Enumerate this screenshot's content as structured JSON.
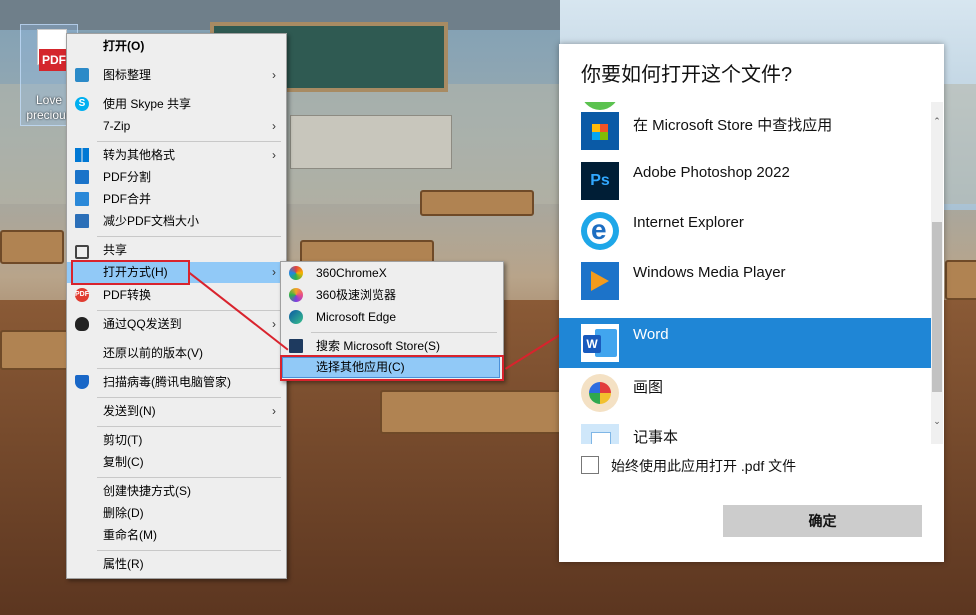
{
  "desktop_icon": {
    "badge": "PDF",
    "label": "Love\nprecious"
  },
  "context_menu": {
    "open": "打开(O)",
    "arrange": "图标整理",
    "skype_share": "使用 Skype 共享",
    "zip": "7-Zip",
    "convert_format": "转为其他格式",
    "pdf_split": "PDF分割",
    "pdf_merge": "PDF合并",
    "pdf_reduce": "减少PDF文档大小",
    "share": "共享",
    "open_with": "打开方式(H)",
    "pdf_convert": "PDF转换",
    "qq_send": "通过QQ发送到",
    "restore": "还原以前的版本(V)",
    "scan_virus": "扫描病毒(腾讯电脑管家)",
    "send_to": "发送到(N)",
    "cut": "剪切(T)",
    "copy": "复制(C)",
    "create_shortcut": "创建快捷方式(S)",
    "delete": "删除(D)",
    "rename": "重命名(M)",
    "properties": "属性(R)",
    "arrow": "›"
  },
  "submenu": {
    "chromex": "360ChromeX",
    "browser360": "360极速浏览器",
    "edge": "Microsoft Edge",
    "search_store": "搜索 Microsoft Store(S)",
    "choose_other": "选择其他应用(C)"
  },
  "dialog": {
    "title": "你要如何打开这个文件?",
    "apps": [
      {
        "name": "在 Microsoft Store 中查找应用",
        "icon": "store-icon"
      },
      {
        "name": "Adobe Photoshop 2022",
        "icon": "photoshop-icon",
        "glyph": "Ps"
      },
      {
        "name": "Internet Explorer",
        "icon": "internet-explorer-icon"
      },
      {
        "name": "Windows Media Player",
        "icon": "media-player-icon"
      },
      {
        "name": "Word",
        "icon": "word-icon",
        "glyph": "W",
        "selected": true
      },
      {
        "name": "画图",
        "icon": "paint-icon"
      },
      {
        "name": "记事本",
        "icon": "notepad-icon"
      }
    ],
    "always_use": "始终使用此应用打开 .pdf 文件",
    "ok": "确定",
    "scroll_up": "⌃",
    "scroll_down": "⌄"
  },
  "colors": {
    "selection": "#1f86d6",
    "menu_highlight": "#91c9f7",
    "annotation_red": "#d9232d"
  }
}
